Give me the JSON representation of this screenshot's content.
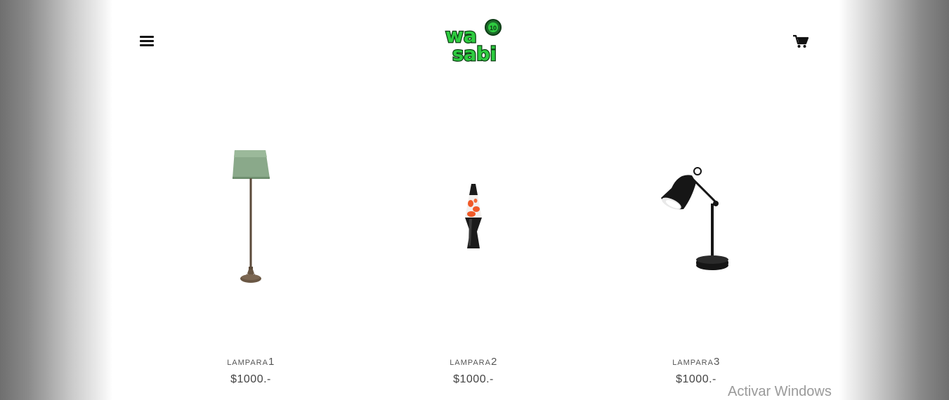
{
  "header": {
    "menu_icon": "hamburger-menu-icon",
    "logo_text_line1": "wa",
    "logo_text_line2": "sabi",
    "logo_badge": "10",
    "logo_color": "#2ecc40",
    "cart_icon": "shopping-cart-icon"
  },
  "products": [
    {
      "name_prefix": "LAMPARA",
      "name_number": "1",
      "price": "$1000.-",
      "image": "floor-lamp"
    },
    {
      "name_prefix": "LAMPARA",
      "name_number": "2",
      "price": "$1000.-",
      "image": "lava-lamp"
    },
    {
      "name_prefix": "LAMPARA",
      "name_number": "3",
      "price": "$1000.-",
      "image": "desk-lamp"
    }
  ],
  "watermark": {
    "text": "Activar Windows"
  }
}
